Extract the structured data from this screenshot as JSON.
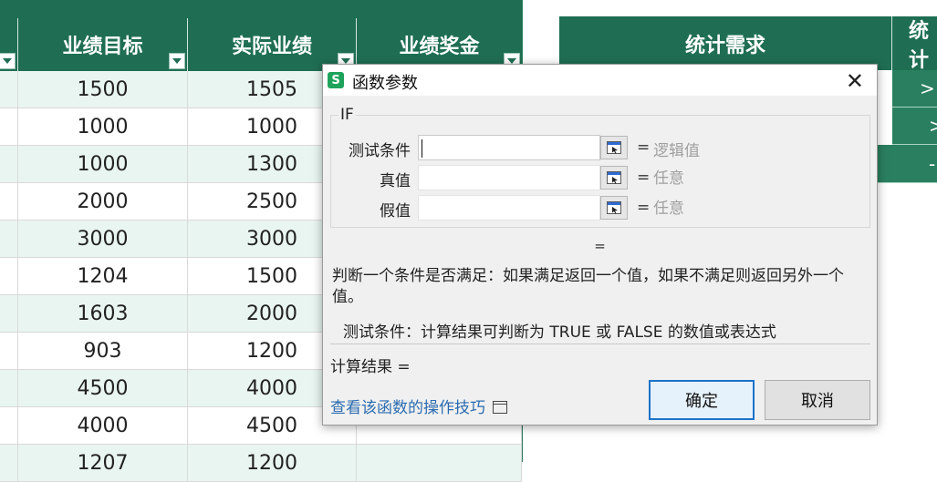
{
  "sheet": {
    "headers": [
      "业绩目标",
      "实际业绩",
      "业绩奖金"
    ],
    "rows": [
      [
        "1500",
        "1505"
      ],
      [
        "1000",
        "1000"
      ],
      [
        "1000",
        "1300"
      ],
      [
        "2000",
        "2500"
      ],
      [
        "3000",
        "3000"
      ],
      [
        "1204",
        "1500"
      ],
      [
        "1603",
        "2000"
      ],
      [
        "903",
        "1200"
      ],
      [
        "4500",
        "4000"
      ],
      [
        "4000",
        "4500"
      ],
      [
        "1207",
        "1200"
      ]
    ]
  },
  "right_table": {
    "header1": "统计需求",
    "header2": "统计",
    "values": [
      ">",
      ">",
      "-"
    ]
  },
  "dialog": {
    "title": "函数参数",
    "app_icon_letter": "S",
    "close_symbol": "✕",
    "function_name": "IF",
    "params": [
      {
        "label": "测试条件",
        "hint": "逻辑值",
        "value": ""
      },
      {
        "label": "真值",
        "hint": "任意",
        "value": ""
      },
      {
        "label": "假值",
        "hint": "任意",
        "value": ""
      }
    ],
    "equals": "=",
    "description": "判断一个条件是否满足：如果满足返回一个值，如果不满足则返回另外一个值。",
    "param_description": "测试条件：计算结果可判断为 TRUE 或 FALSE 的数值或表达式",
    "result_label": "计算结果 =",
    "help_link": "查看该函数的操作技巧",
    "ok_label": "确定",
    "cancel_label": "取消"
  },
  "colors": {
    "header_green": "#1f6e53",
    "row_alt": "#e9f5f0",
    "link_blue": "#2b6cb0",
    "ok_border": "#1b73c8"
  }
}
